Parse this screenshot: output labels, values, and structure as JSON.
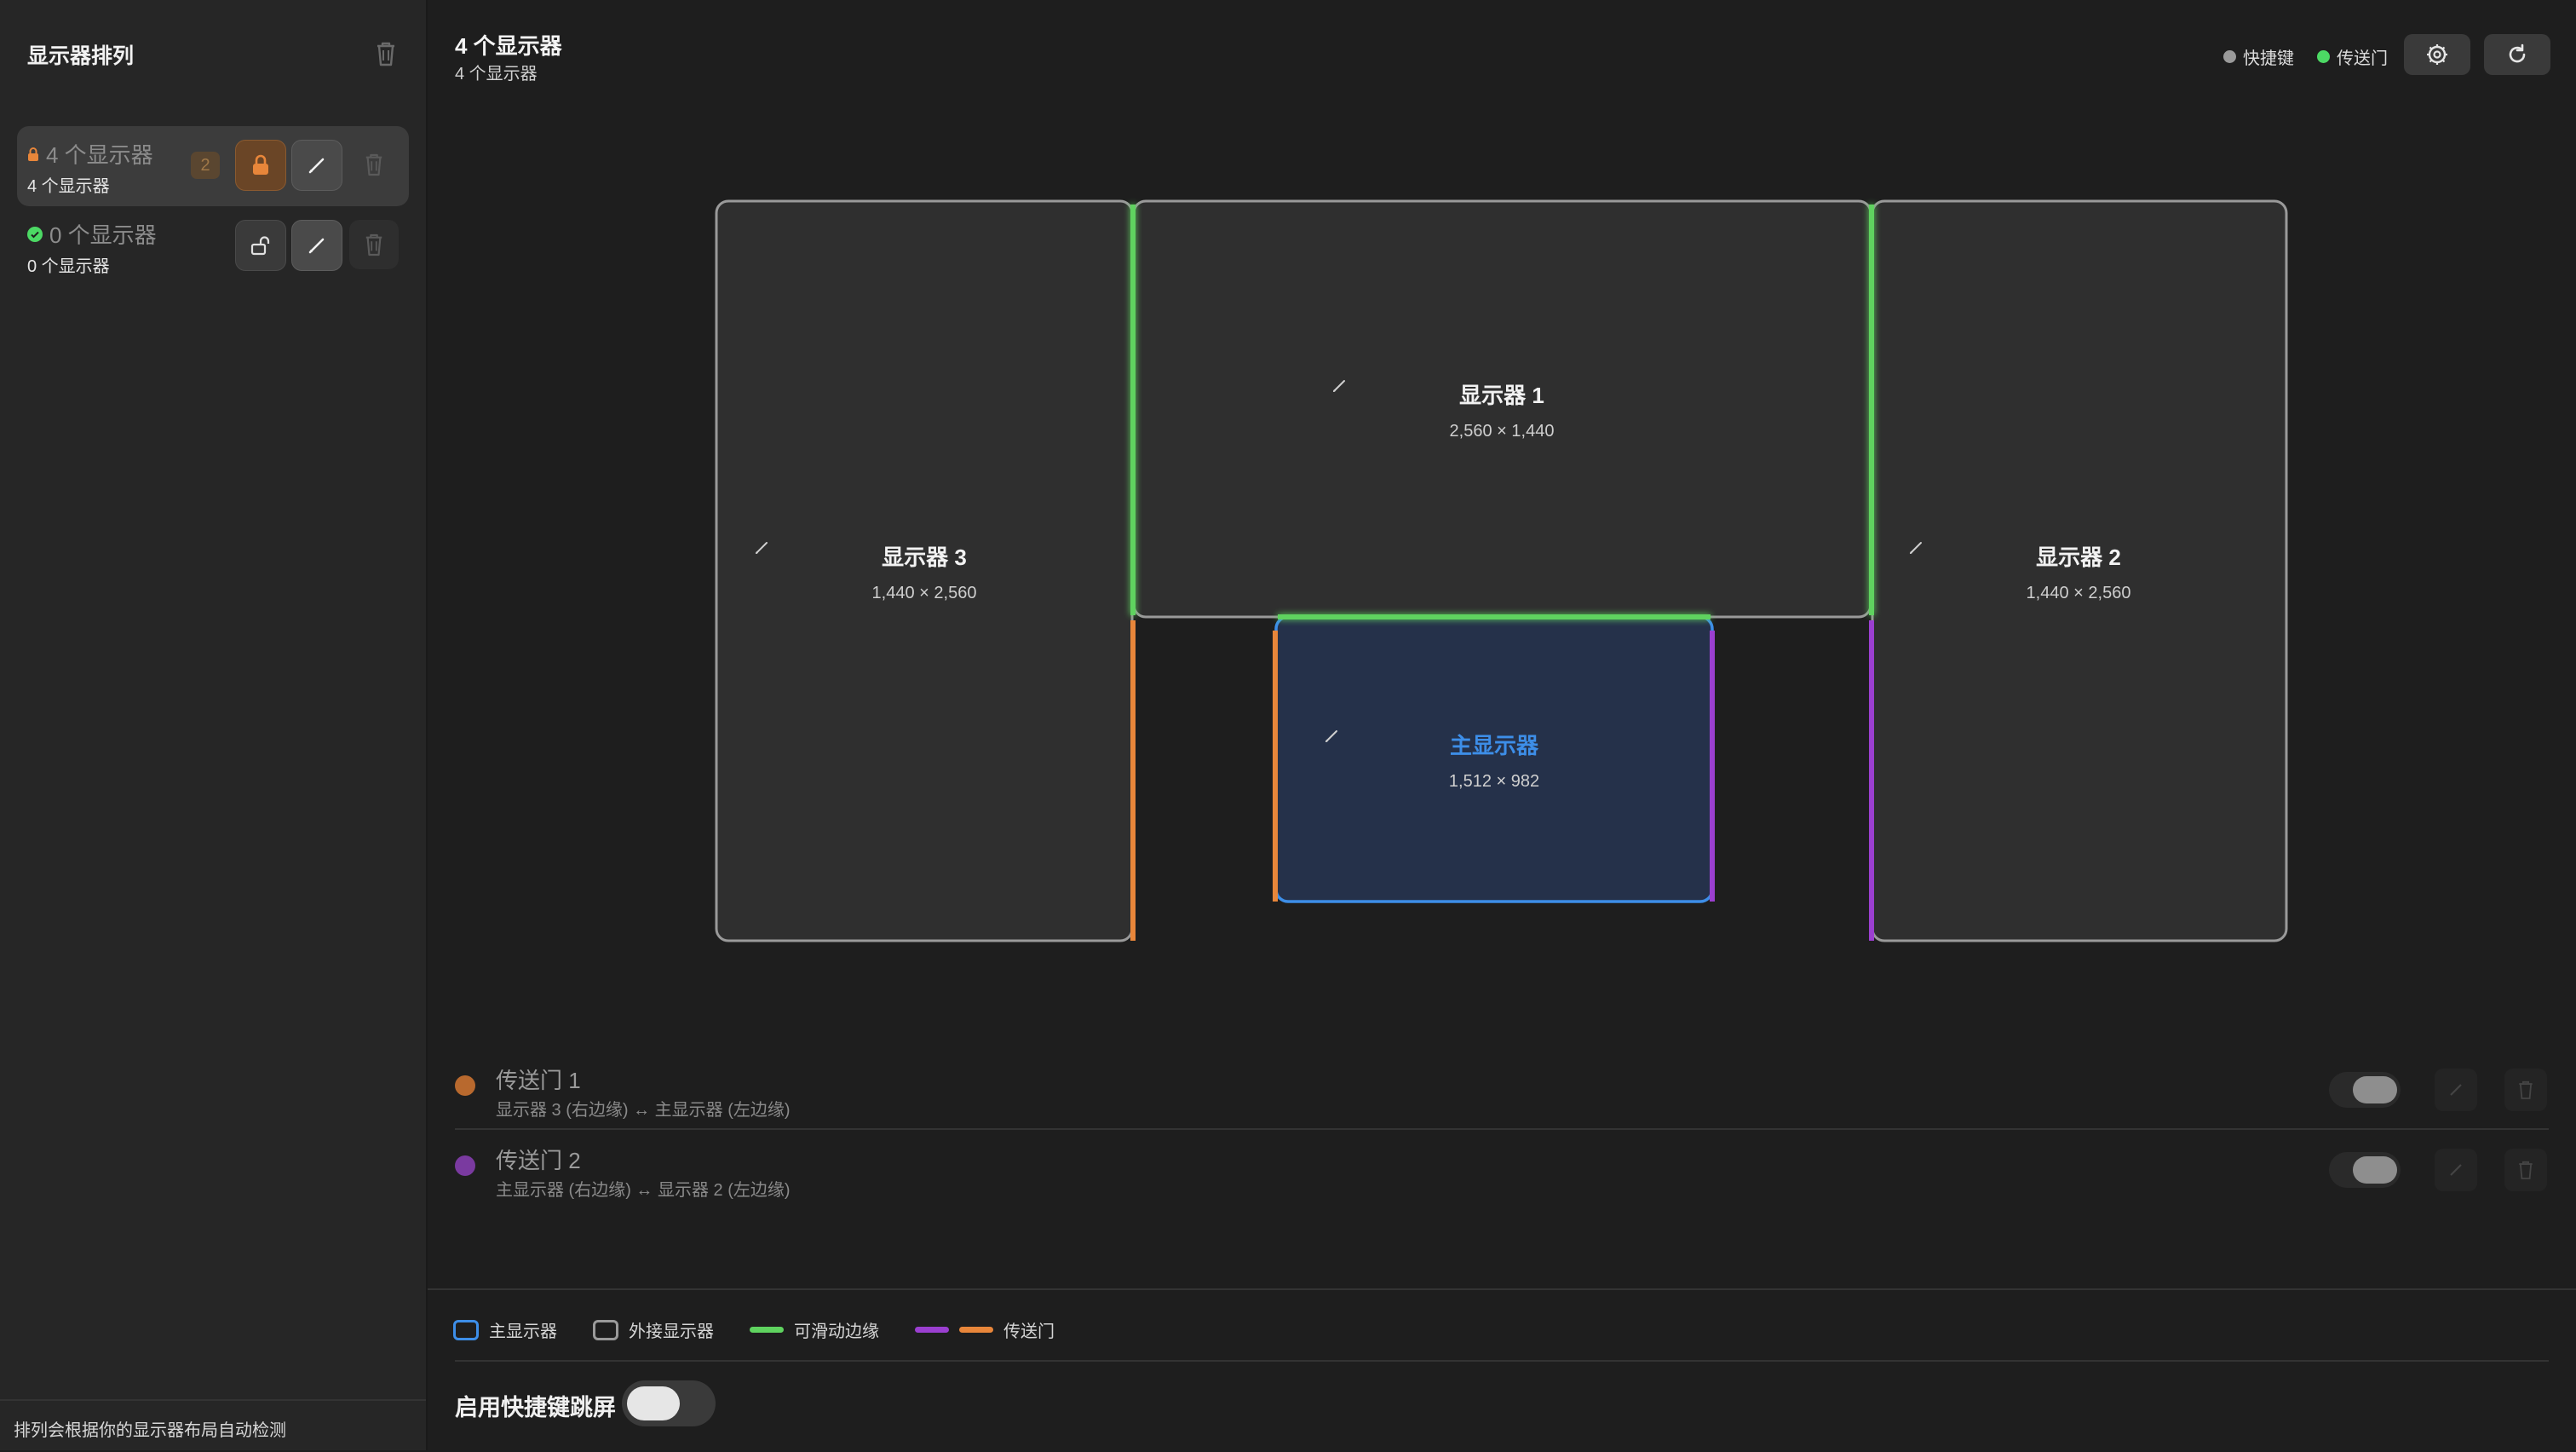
{
  "sidebar": {
    "title": "显示器排列",
    "items": [
      {
        "name": "4 个显示器",
        "sub": "4 个显示器",
        "badge": "2",
        "locked": true,
        "selected": true
      },
      {
        "name": "0 个显示器",
        "sub": "0 个显示器",
        "locked": false,
        "selected": false
      }
    ],
    "footer": "排列会根据你的显示器布局自动检测"
  },
  "header": {
    "title": "4 个显示器",
    "subtitle": "4 个显示器",
    "legend": [
      {
        "label": "快捷键",
        "color": "#9a9a9a"
      },
      {
        "label": "传送门",
        "color": "#4cd964"
      }
    ]
  },
  "monitors": [
    {
      "name": "显示器 1",
      "resolution": "2,560 × 1,440",
      "main": false
    },
    {
      "name": "显示器 3",
      "resolution": "1,440 × 2,560",
      "main": false
    },
    {
      "name": "显示器 2",
      "resolution": "1,440 × 2,560",
      "main": false
    },
    {
      "name": "主显示器",
      "resolution": "1,512 × 982",
      "main": true
    }
  ],
  "portals": [
    {
      "name": "传送门 1",
      "desc": "显示器 3 (右边缘) ↔ 主显示器 (左边缘)",
      "color": "#b8692e",
      "enabled": true
    },
    {
      "name": "传送门 2",
      "desc": "主显示器 (右边缘) ↔ 显示器 2 (左边缘)",
      "color": "#7a3aa0",
      "enabled": true
    }
  ],
  "legend_bottom": {
    "main_display": "主显示器",
    "external_display": "外接显示器",
    "slidable_edge": "可滑动边缘",
    "portal": "传送门"
  },
  "hotkey": {
    "label": "启用快捷键跳屏",
    "enabled": false
  },
  "colors": {
    "accent_blue": "#3d8ee8",
    "edge_green": "#5fd35f",
    "portal_orange": "#e8863a",
    "portal_purple": "#9b3fd0"
  }
}
